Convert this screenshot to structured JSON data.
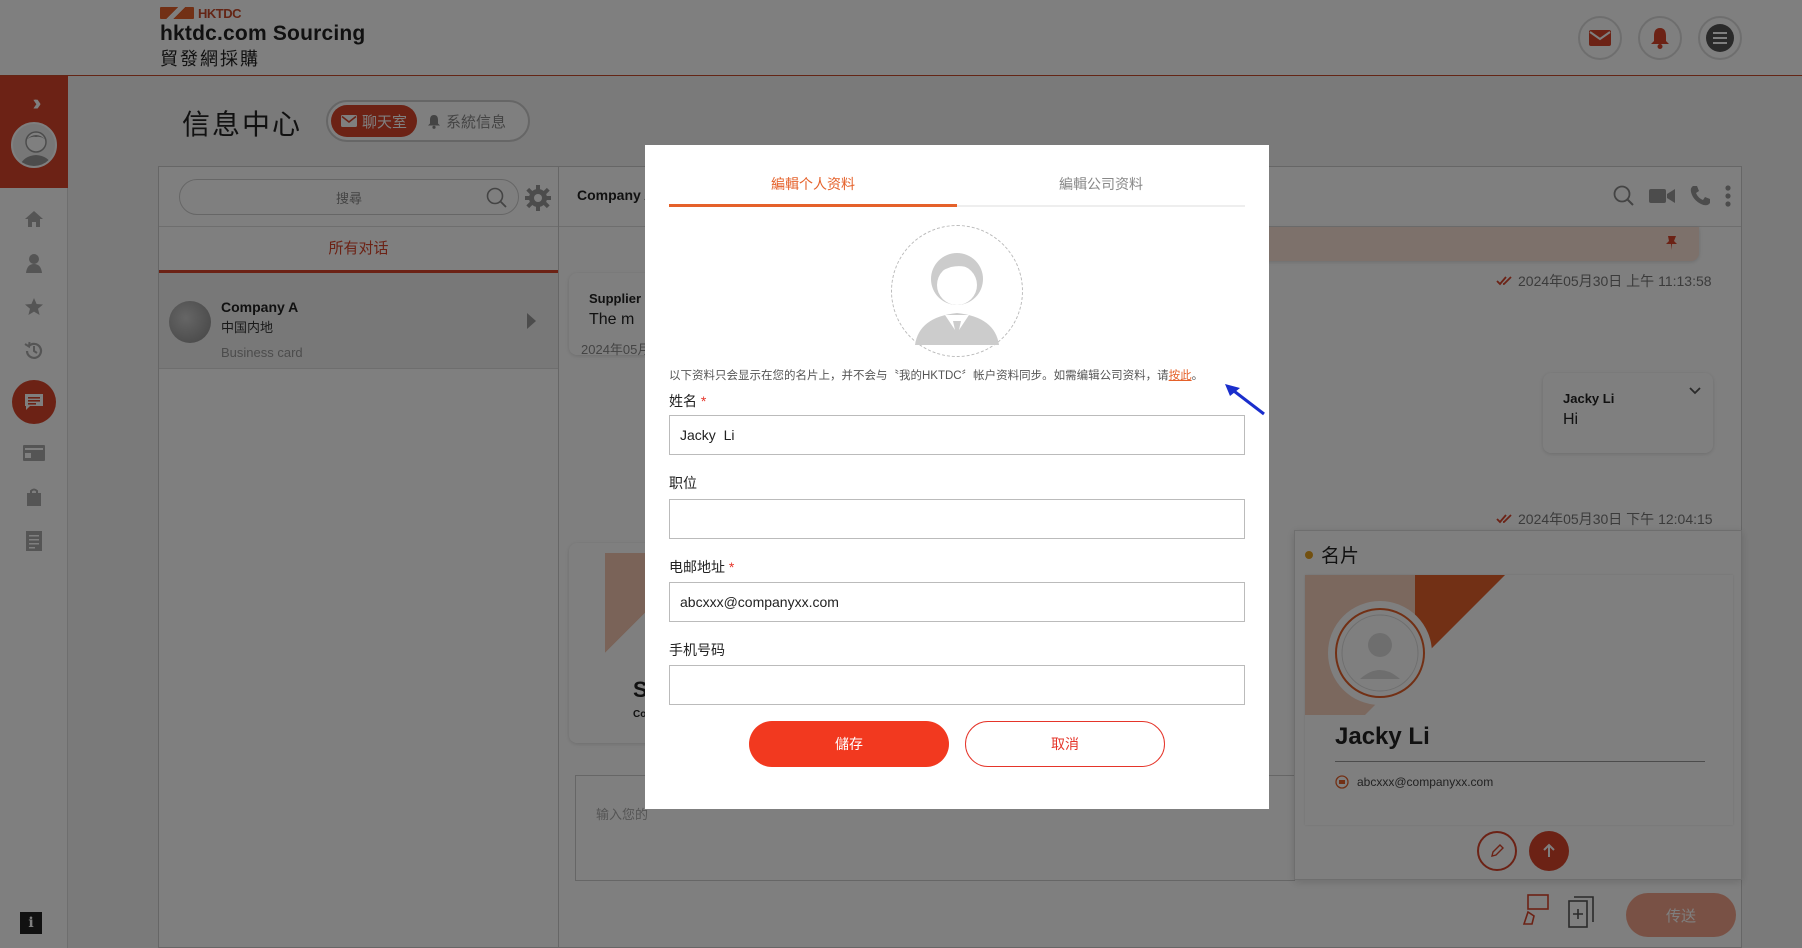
{
  "header": {
    "logo_mark_text": "HKTDC",
    "logo_en": "hktdc.com Sourcing",
    "logo_zh": "貿發網採購",
    "icons": [
      "mail-icon",
      "bell-icon",
      "menu-icon"
    ]
  },
  "sidebar": {
    "expand_icon": "double-chevron-right-icon",
    "info_label": "i",
    "items": [
      "home-icon",
      "person-icon",
      "star-icon",
      "history-icon",
      "chat-icon",
      "card-icon",
      "bag-icon",
      "list-icon"
    ]
  },
  "page": {
    "title": "信息中心",
    "tab_chat": "聊天室",
    "tab_system": "系統信息"
  },
  "conversations": {
    "search_placeholder": "搜尋",
    "tab_all": "所有对话",
    "items": [
      {
        "name": "Company A",
        "region": "中国内地",
        "meta": "Business card"
      }
    ]
  },
  "chat": {
    "header_name": "Company A",
    "msg1_sender": "Supplier",
    "msg1_text": "The m",
    "msg1_time": "2024年05月",
    "pinned_time": "2024年05月30日 上午 11:13:58",
    "msg2_sender": "Jacky Li",
    "msg2_text": "Hi",
    "msg2_time": "2024年05月30日 下午 12:04:15",
    "card_partial_initial": "S",
    "card_partial_sub": "Co",
    "input_placeholder": "输入您的",
    "send_label": "传送"
  },
  "card_preview": {
    "title": "名片",
    "name": "Jacky Li",
    "email": "abcxxx@companyxx.com"
  },
  "modal": {
    "tab_personal": "編輯个人资料",
    "tab_company": "編輯公司资料",
    "note_text": "以下资料只会显示在您的名片上，并不会与〝我的HKTDC〞帐户资料同步。如需编辑公司资料，请",
    "note_link": "按此",
    "note_end": "。",
    "name_label": "姓名",
    "name_value": "Jacky  Li",
    "position_label": "职位",
    "position_value": "",
    "email_label": "电邮地址",
    "email_value": "abcxxx@companyxx.com",
    "phone_label": "手机号码",
    "phone_value": "",
    "required_mark": "*",
    "save_label": "儲存",
    "cancel_label": "取消"
  },
  "colors": {
    "brand": "#d8442a",
    "accent": "#e5612a",
    "save": "#f2391f",
    "annotation_arrow": "#1a2ecc"
  }
}
